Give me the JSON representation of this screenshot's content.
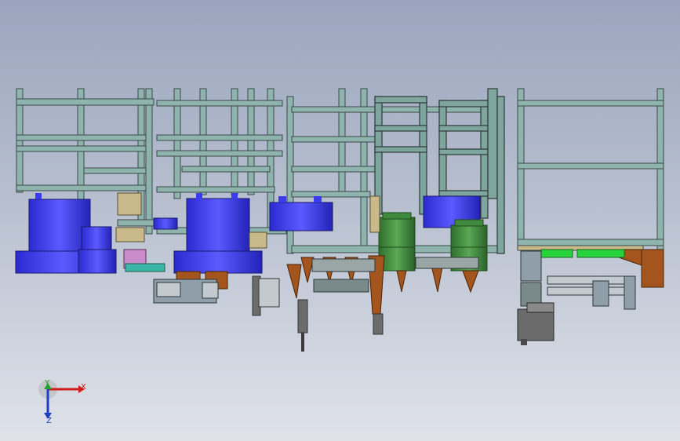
{
  "viewport": {
    "background_top": "#9aa5bd",
    "background_bottom": "#dfe2e9"
  },
  "colors": {
    "frame": "#8fb3ad",
    "frame_edge": "#3b4a4a",
    "motor_blue": "#3b3bef",
    "cylinder_green": "#3f8a3c",
    "bracket_brown": "#a3551d",
    "plate_tan": "#c9b98b",
    "gear_grey": "#6b6b6b",
    "roller_green": "#27d33a"
  },
  "triad": {
    "x_label": "X",
    "y_label": "Y",
    "z_label": "Z",
    "x_color": "#d01c1c",
    "y_color": "#21a22a",
    "z_color": "#1d3fc4"
  }
}
